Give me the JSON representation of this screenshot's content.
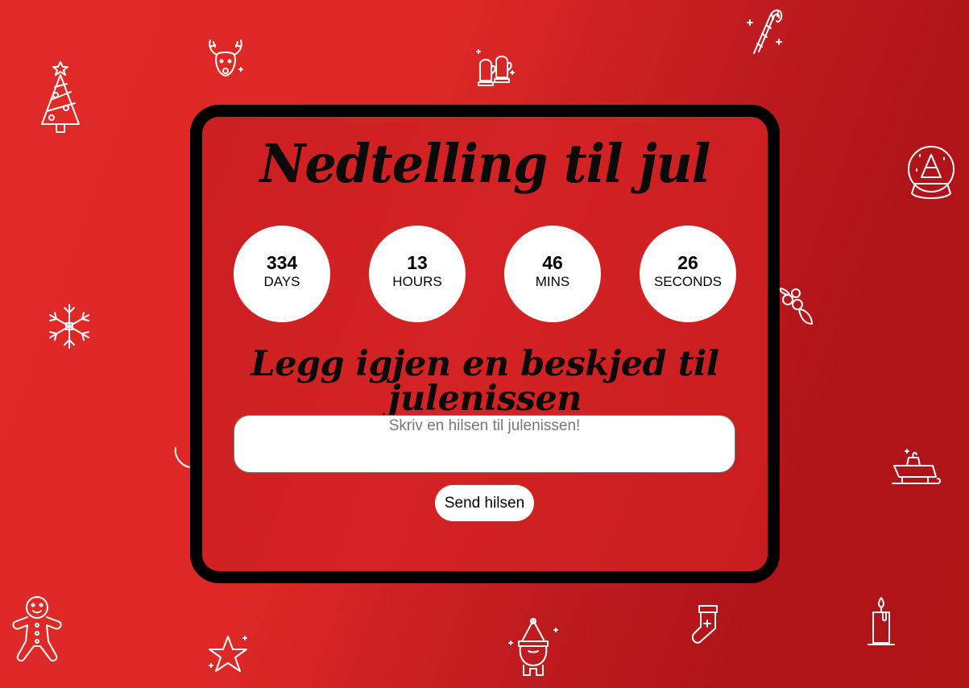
{
  "countdown": {
    "title": "Nedtelling til jul",
    "units": [
      {
        "value": "334",
        "label": "DAYS"
      },
      {
        "value": "13",
        "label": "HOURS"
      },
      {
        "value": "46",
        "label": "MINS"
      },
      {
        "value": "26",
        "label": "SECONDS"
      }
    ]
  },
  "message": {
    "heading": "Legg igjen en beskjed til julenissen",
    "placeholder": "Skriv en hilsen til julenissen!",
    "value": "",
    "send_label": "Send hilsen"
  },
  "decorations": [
    "christmas-tree-icon",
    "reindeer-icon",
    "mittens-icon",
    "candy-cane-icon",
    "snow-globe-icon",
    "snowflake-icon",
    "holly-icon",
    "sleigh-icon",
    "gingerbread-man-icon",
    "star-icon",
    "santa-icon",
    "stocking-icon",
    "candle-icon"
  ],
  "colors": {
    "background": "#d42324",
    "card_border": "#000000",
    "circle": "#ffffff",
    "text": "#000000"
  }
}
